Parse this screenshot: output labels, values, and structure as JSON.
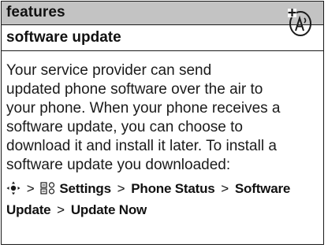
{
  "header": {
    "title": "features"
  },
  "section": {
    "title": "software update",
    "icon": "network-feature-icon"
  },
  "body": {
    "text": "Your service provider can send\nupdated phone software over the air to\nyour phone. When your phone receives a\nsoftware update, you can choose to\ndownload it and install it later. To install a\nsoftware update you downloaded:"
  },
  "navigation": {
    "nav_key_icon": "nav-key-icon",
    "settings_icon": "settings-icon",
    "separator": ">",
    "items": [
      "Settings",
      "Phone Status",
      "Software",
      "Update",
      "Update Now"
    ]
  }
}
